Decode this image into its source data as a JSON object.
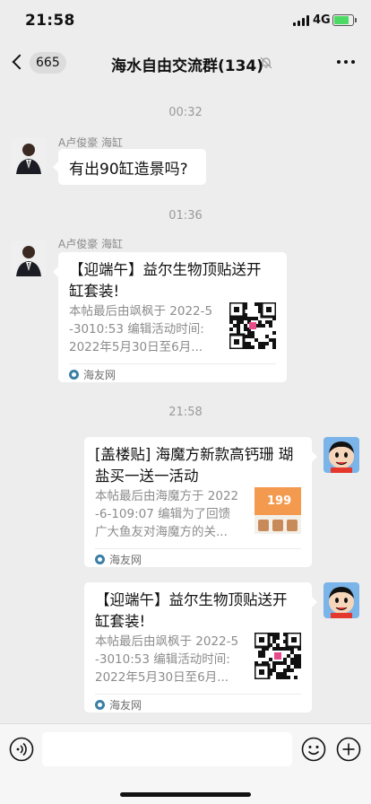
{
  "status_bar": {
    "time": "21:58",
    "network": "4G",
    "battery_level": 0.8
  },
  "nav": {
    "back_count": "665",
    "title": "海水自由交流群(134)",
    "muted": true
  },
  "messages": [
    {
      "timestamp": "00:32"
    },
    {
      "sender": "A卢俊豪 海缸",
      "text": "有出90缸造景吗?"
    },
    {
      "timestamp": "01:36"
    },
    {
      "sender": "A卢俊豪 海缸",
      "card": {
        "title_lines": [
          "【迎端午】益尔生物顶贴送开",
          "缸套装!"
        ],
        "desc_lines": [
          "本帖最后由飒枫于 2022-5",
          "-3010:53 编辑活动时间:",
          "2022年5月30日至6月..."
        ],
        "source": "海友网",
        "thumb": "qr-code"
      }
    },
    {
      "timestamp": "21:58"
    },
    {
      "from_self": true,
      "card": {
        "title_lines": [
          "[盖楼贴] 海魔方新款高钙珊 瑚",
          "盐买一送一活动"
        ],
        "desc_lines": [
          "本帖最后由海魔方于 2022",
          "-6-109:07 编辑为了回馈",
          "广大鱼友对海魔方的关..."
        ],
        "source": "海友网",
        "thumb": "product-image",
        "thumb_text": "199"
      }
    },
    {
      "from_self": true,
      "card": {
        "title_lines": [
          "【迎端午】益尔生物顶贴送开",
          "缸套装!"
        ],
        "desc_lines": [
          "本帖最后由飒枫于 2022-5",
          "-3010:53 编辑活动时间:",
          "2022年5月30日至6月..."
        ],
        "source": "海友网",
        "thumb": "qr-code"
      }
    }
  ],
  "input": {
    "placeholder": ""
  },
  "icons": {
    "back": "chevron-left-icon",
    "mute": "bell-off-icon",
    "more": "more-dots-icon",
    "voice": "voice-icon",
    "emoji": "emoji-icon",
    "plus": "plus-icon"
  },
  "colors": {
    "background": "#ededed",
    "bubble": "#ffffff",
    "battery": "#4cd964"
  }
}
